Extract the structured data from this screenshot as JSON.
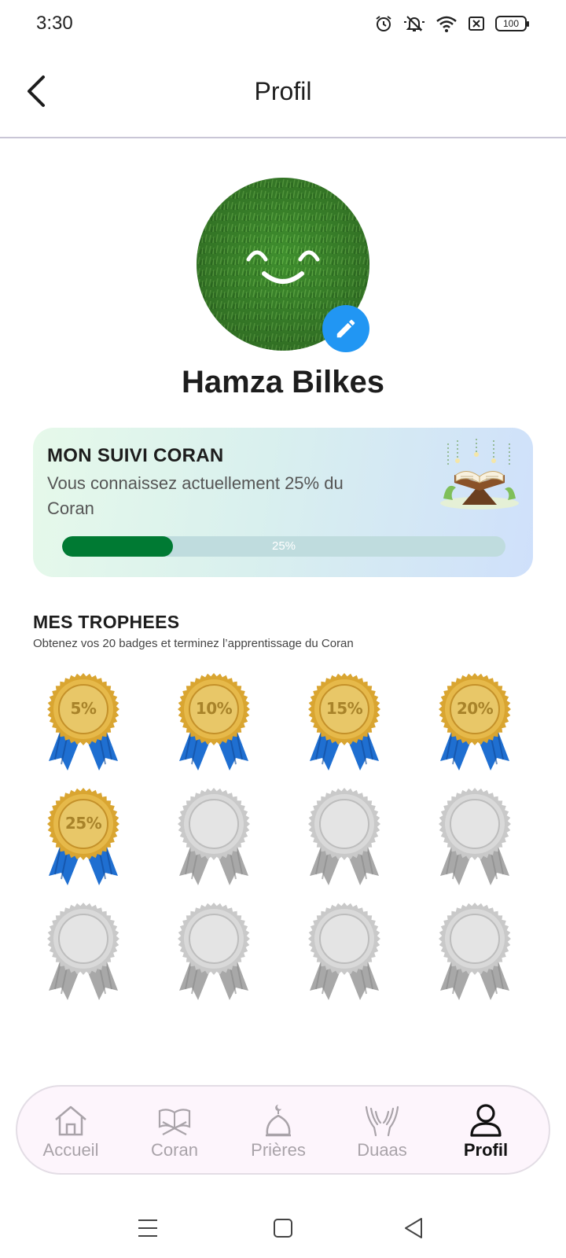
{
  "status_bar": {
    "time": "3:30",
    "battery": "100"
  },
  "header": {
    "title": "Profil"
  },
  "profile": {
    "name": "Hamza Bilkes"
  },
  "quran_card": {
    "title": "MON SUIVI CORAN",
    "text": "Vous connaissez actuellement 25% du Coran",
    "progress_label": "25%",
    "progress_fraction": 0.25
  },
  "trophies": {
    "title": "MES TROPHEES",
    "subtitle": "Obtenez vos 20 badges et terminez l’apprentissage du Coran",
    "badges": [
      {
        "label": "5%",
        "earned": true
      },
      {
        "label": "10%",
        "earned": true
      },
      {
        "label": "15%",
        "earned": true
      },
      {
        "label": "20%",
        "earned": true
      },
      {
        "label": "25%",
        "earned": true
      },
      {
        "label": "",
        "earned": false
      },
      {
        "label": "",
        "earned": false
      },
      {
        "label": "",
        "earned": false
      },
      {
        "label": "",
        "earned": false
      },
      {
        "label": "",
        "earned": false
      },
      {
        "label": "",
        "earned": false
      },
      {
        "label": "",
        "earned": false
      }
    ]
  },
  "bottom_nav": {
    "items": [
      {
        "label": "Accueil",
        "icon": "home-icon",
        "active": false
      },
      {
        "label": "Coran",
        "icon": "quran-book-icon",
        "active": false
      },
      {
        "label": "Prières",
        "icon": "mosque-dome-icon",
        "active": false
      },
      {
        "label": "Duaas",
        "icon": "praying-hands-icon",
        "active": false
      },
      {
        "label": "Profil",
        "icon": "person-icon",
        "active": true
      }
    ]
  },
  "colors": {
    "accent_blue": "#2196f3",
    "progress_green": "#007a33",
    "gold": "#e6b94a",
    "ribbon_blue": "#1f6fd1",
    "silver": "#d9d9d9"
  }
}
